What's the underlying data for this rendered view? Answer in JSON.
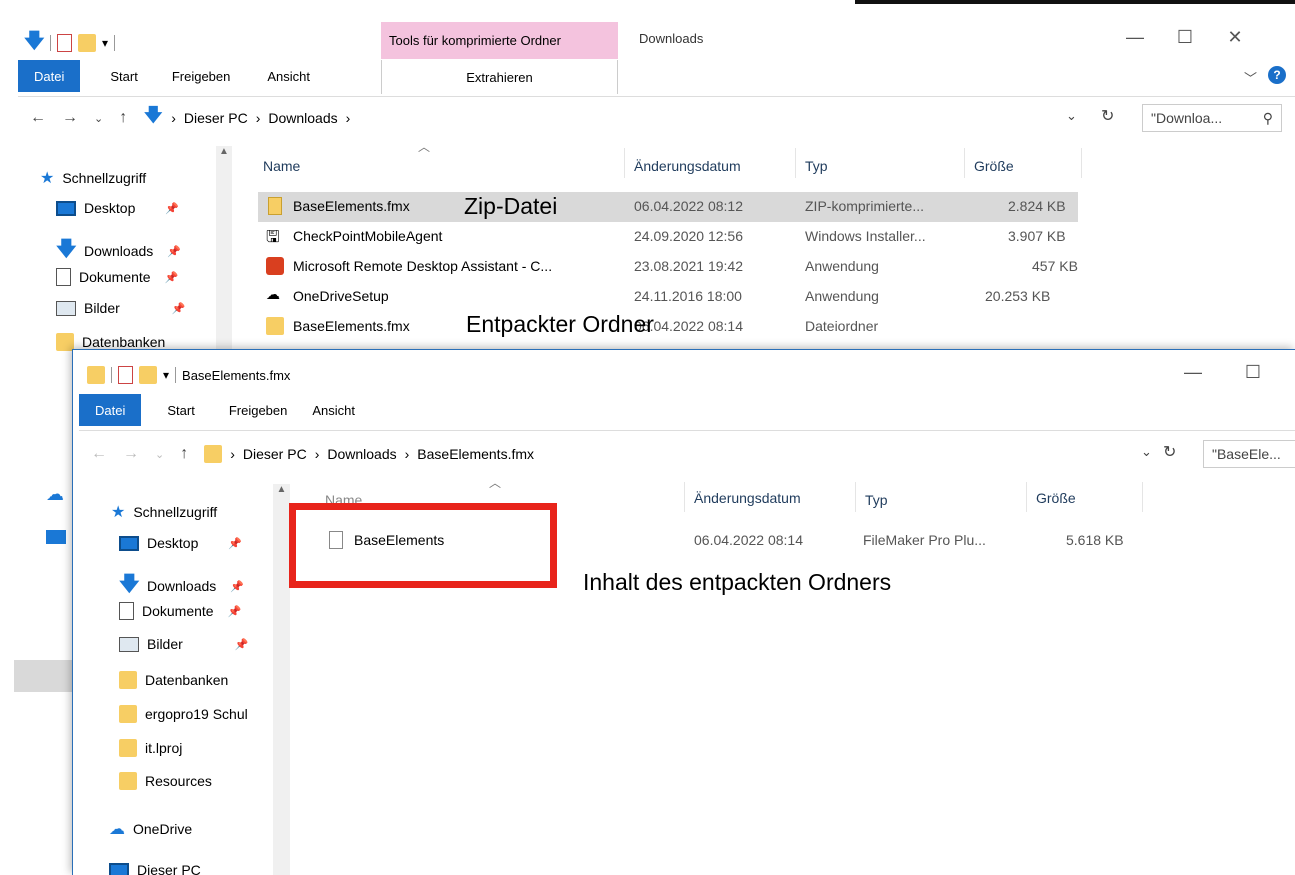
{
  "back_window": {
    "title": "Downloads",
    "context_tab_header": "Tools für komprimierte Ordner",
    "context_tab_label": "Extrahieren",
    "ribbon_tabs": [
      "Datei",
      "Start",
      "Freigeben",
      "Ansicht"
    ],
    "breadcrumb": [
      "Dieser PC",
      "Downloads"
    ],
    "search_placeholder": "\"Downloa...",
    "nav_items": [
      {
        "label": "Schnellzugriff",
        "icon": "star-icon"
      },
      {
        "label": "Desktop",
        "icon": "desktop-icon",
        "pinned": true
      },
      {
        "label": "Downloads",
        "icon": "download-arrow-icon",
        "pinned": true
      },
      {
        "label": "Dokumente",
        "icon": "documents-icon",
        "pinned": true
      },
      {
        "label": "Bilder",
        "icon": "pictures-icon",
        "pinned": true
      },
      {
        "label": "Datenbanken",
        "icon": "folder-icon"
      }
    ],
    "columns": [
      "Name",
      "Änderungsdatum",
      "Typ",
      "Größe"
    ],
    "rows": [
      {
        "name": "BaseElements.fmx",
        "date": "06.04.2022 08:12",
        "type": "ZIP-komprimierte...",
        "size": "2.824 KB",
        "icon": "zip-folder-icon",
        "selected": true
      },
      {
        "name": "CheckPointMobileAgent",
        "date": "24.09.2020 12:56",
        "type": "Windows Installer...",
        "size": "3.907 KB",
        "icon": "installer-icon"
      },
      {
        "name": "Microsoft Remote Desktop Assistant - C...",
        "date": "23.08.2021 19:42",
        "type": "Anwendung",
        "size": "457 KB",
        "icon": "remote-desktop-icon"
      },
      {
        "name": "OneDriveSetup",
        "date": "24.11.2016 18:00",
        "type": "Anwendung",
        "size": "20.253 KB",
        "icon": "onedrive-icon"
      },
      {
        "name": "BaseElements.fmx",
        "date": "06.04.2022 08:14",
        "type": "Dateiordner",
        "size": "",
        "icon": "folder-icon"
      }
    ]
  },
  "annotations": {
    "zip": "Zip-Datei",
    "extracted": "Entpackter Ordner",
    "content": "Inhalt des entpackten Ordners"
  },
  "front_window": {
    "title": "BaseElements.fmx",
    "ribbon_tabs": [
      "Datei",
      "Start",
      "Freigeben",
      "Ansicht"
    ],
    "breadcrumb": [
      "Dieser PC",
      "Downloads",
      "BaseElements.fmx"
    ],
    "search_placeholder": "\"BaseEle...",
    "nav_items": [
      {
        "label": "Schnellzugriff",
        "icon": "star-icon"
      },
      {
        "label": "Desktop",
        "icon": "desktop-icon",
        "pinned": true
      },
      {
        "label": "Downloads",
        "icon": "download-arrow-icon",
        "pinned": true
      },
      {
        "label": "Dokumente",
        "icon": "documents-icon",
        "pinned": true
      },
      {
        "label": "Bilder",
        "icon": "pictures-icon",
        "pinned": true
      },
      {
        "label": "Datenbanken",
        "icon": "folder-icon"
      },
      {
        "label": "ergopro19 Schul",
        "icon": "folder-icon"
      },
      {
        "label": "it.lproj",
        "icon": "folder-icon"
      },
      {
        "label": "Resources",
        "icon": "folder-icon"
      },
      {
        "label": "OneDrive",
        "icon": "onedrive-icon"
      },
      {
        "label": "Dieser PC",
        "icon": "pc-icon"
      }
    ],
    "columns": [
      "Name",
      "Änderungsdatum",
      "Typ",
      "Größe"
    ],
    "rows": [
      {
        "name": "BaseElements",
        "date": "06.04.2022 08:14",
        "type": "FileMaker Pro Plu...",
        "size": "5.618 KB",
        "icon": "file-icon"
      }
    ]
  },
  "colors": {
    "accent": "#1a6fc9",
    "context_tab": "#f4c3de",
    "highlight_box": "#e8241b",
    "folder": "#f7ce64"
  }
}
